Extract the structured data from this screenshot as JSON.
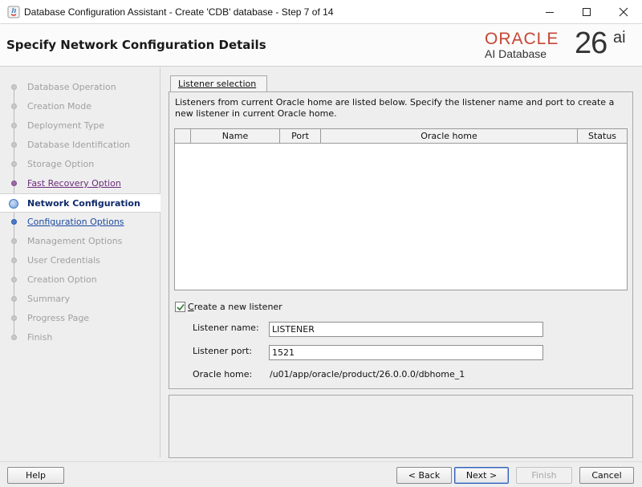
{
  "window": {
    "title": "Database Configuration Assistant - Create 'CDB' database - Step 7 of 14"
  },
  "header": {
    "heading": "Specify Network Configuration Details",
    "logo_brand": "ORACLE",
    "logo_product": "AI Database",
    "logo_version": "26",
    "logo_version_suffix": "ai",
    "brand_color": "#c74634"
  },
  "steps": [
    {
      "label": "Database Operation",
      "state": "disabled"
    },
    {
      "label": "Creation Mode",
      "state": "disabled"
    },
    {
      "label": "Deployment Type",
      "state": "disabled"
    },
    {
      "label": "Database Identification",
      "state": "disabled"
    },
    {
      "label": "Storage Option",
      "state": "disabled"
    },
    {
      "label": "Fast Recovery Option",
      "state": "visited"
    },
    {
      "label": "Network Configuration",
      "state": "current"
    },
    {
      "label": "Configuration Options",
      "state": "link"
    },
    {
      "label": "Management Options",
      "state": "disabled"
    },
    {
      "label": "User Credentials",
      "state": "disabled"
    },
    {
      "label": "Creation Option",
      "state": "disabled"
    },
    {
      "label": "Summary",
      "state": "disabled"
    },
    {
      "label": "Progress Page",
      "state": "disabled"
    },
    {
      "label": "Finish",
      "state": "disabled"
    }
  ],
  "main": {
    "tab_label": "Listener selection",
    "description": "Listeners from current Oracle home are listed below. Specify the listener name and port to create a new listener in current Oracle home.",
    "table": {
      "columns": [
        "",
        "Name",
        "Port",
        "Oracle home",
        "Status"
      ],
      "rows": []
    },
    "create_listener": {
      "label": "Create a new listener",
      "checked": true
    },
    "listener_name": {
      "label": "Listener name:",
      "value": "LISTENER"
    },
    "listener_port": {
      "label": "Listener port:",
      "value": "1521"
    },
    "oracle_home": {
      "label": "Oracle home:",
      "value": "/u01/app/oracle/product/26.0.0.0/dbhome_1"
    }
  },
  "buttons": {
    "help": "Help",
    "back": "< Back",
    "next": "Next >",
    "finish": "Finish",
    "cancel": "Cancel"
  }
}
